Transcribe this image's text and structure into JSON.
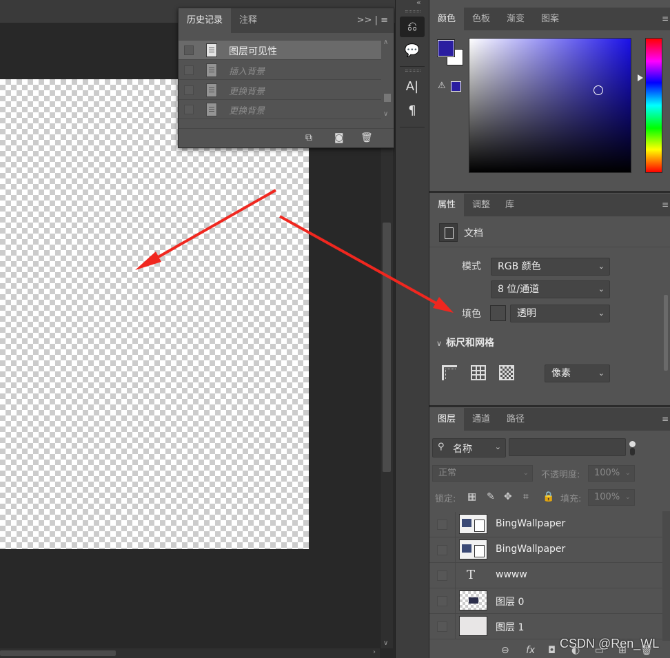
{
  "history": {
    "tabs": [
      {
        "label": "历史记录"
      },
      {
        "label": "注释"
      }
    ],
    "menu": ">> | ≡",
    "items": [
      {
        "label": "图层可见性"
      },
      {
        "label": "插入背景"
      },
      {
        "label": "更换背景"
      },
      {
        "label": "更换背景"
      }
    ],
    "footer_icons": [
      "new-document-from-state-icon",
      "snapshot-camera-icon",
      "trash-icon"
    ]
  },
  "toolstrip": {
    "collapse_glyph": "«",
    "history_glyph": "⎌",
    "comment_glyph": "💬",
    "character_glyph": "A|",
    "paragraph_glyph": "¶"
  },
  "color": {
    "tabs": [
      {
        "label": "颜色"
      },
      {
        "label": "色板"
      },
      {
        "label": "渐变"
      },
      {
        "label": "图案"
      }
    ],
    "menu": "≡",
    "foreground": "#2a1ea0",
    "background": "#ffffff",
    "warning_glyph": "⚠"
  },
  "properties": {
    "tabs": [
      {
        "label": "属性"
      },
      {
        "label": "调整"
      },
      {
        "label": "库"
      }
    ],
    "menu": "≡",
    "section": "文档",
    "mode_label": "模式",
    "mode_value": "RGB 颜色",
    "depth_value": "8 位/通道",
    "fill_label": "填色",
    "fill_value": "透明",
    "rulers_title": "标尺和网格",
    "unit_value": "像素",
    "caret": "⌄",
    "chevron": "∨"
  },
  "layers": {
    "tabs": [
      {
        "label": "图层"
      },
      {
        "label": "通道"
      },
      {
        "label": "路径"
      }
    ],
    "menu": "≡",
    "filter_value": "名称",
    "blend_mode": "正常",
    "opacity_label": "不透明度:",
    "opacity_value": "100%",
    "lock_label": "锁定:",
    "fill_label": "填充:",
    "fill_value": "100%",
    "rows": [
      {
        "name": "BingWallpaper",
        "kind": "smart"
      },
      {
        "name": "BingWallpaper",
        "kind": "smart"
      },
      {
        "name": "wwww",
        "kind": "text"
      },
      {
        "name": "图层 0",
        "kind": "pixel"
      },
      {
        "name": "图层 1",
        "kind": "fill"
      }
    ],
    "footer_icons": [
      "link-icon",
      "fx-icon",
      "mask-icon",
      "adjustment-icon",
      "group-folder-icon",
      "new-layer-icon",
      "delete-icon"
    ]
  },
  "watermark": "CSDN @Ren_WL",
  "annotation": {
    "arrow_color": "#f0271f"
  }
}
